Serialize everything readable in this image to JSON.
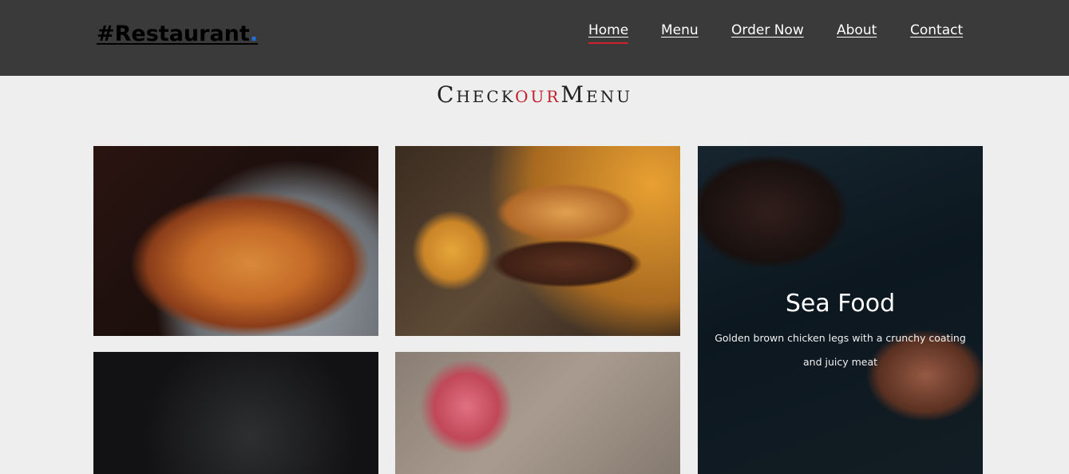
{
  "header": {
    "logo_text": "#Restaurant",
    "logo_dot": ".",
    "nav": [
      {
        "label": "Home",
        "active": true
      },
      {
        "label": "Menu",
        "active": false
      },
      {
        "label": "Order Now",
        "active": false
      },
      {
        "label": "About",
        "active": false
      },
      {
        "label": "Contact",
        "active": false
      }
    ]
  },
  "menu_section": {
    "title_part1": "Check",
    "title_part2": "our",
    "title_part3": "Menu"
  },
  "cards": {
    "featured": {
      "title": "Sea Food",
      "description": "Golden brown chicken legs with a crunchy coating and juicy meat"
    }
  },
  "colors": {
    "header_bg": "#393a39",
    "page_bg": "#eeeeee",
    "accent_red": "#c0202d",
    "logo_dot": "#1f6fe0"
  }
}
